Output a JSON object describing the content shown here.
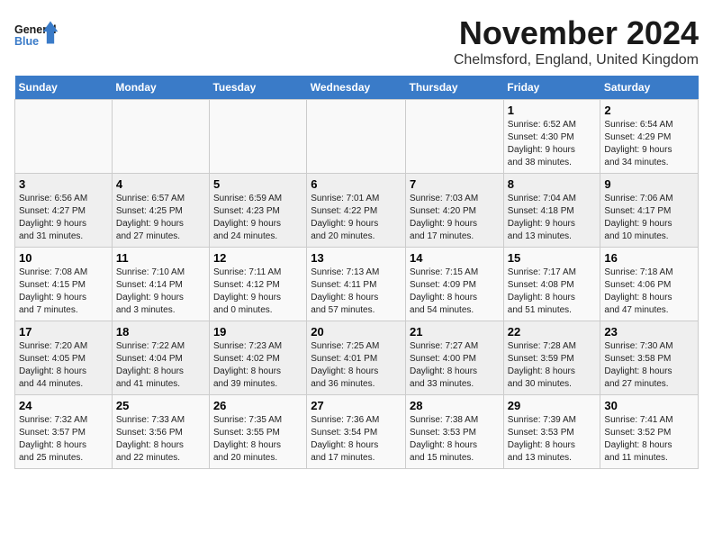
{
  "logo": {
    "line1": "General",
    "line2": "Blue"
  },
  "title": "November 2024",
  "location": "Chelmsford, England, United Kingdom",
  "weekdays": [
    "Sunday",
    "Monday",
    "Tuesday",
    "Wednesday",
    "Thursday",
    "Friday",
    "Saturday"
  ],
  "weeks": [
    [
      {
        "day": "",
        "detail": ""
      },
      {
        "day": "",
        "detail": ""
      },
      {
        "day": "",
        "detail": ""
      },
      {
        "day": "",
        "detail": ""
      },
      {
        "day": "",
        "detail": ""
      },
      {
        "day": "1",
        "detail": "Sunrise: 6:52 AM\nSunset: 4:30 PM\nDaylight: 9 hours\nand 38 minutes."
      },
      {
        "day": "2",
        "detail": "Sunrise: 6:54 AM\nSunset: 4:29 PM\nDaylight: 9 hours\nand 34 minutes."
      }
    ],
    [
      {
        "day": "3",
        "detail": "Sunrise: 6:56 AM\nSunset: 4:27 PM\nDaylight: 9 hours\nand 31 minutes."
      },
      {
        "day": "4",
        "detail": "Sunrise: 6:57 AM\nSunset: 4:25 PM\nDaylight: 9 hours\nand 27 minutes."
      },
      {
        "day": "5",
        "detail": "Sunrise: 6:59 AM\nSunset: 4:23 PM\nDaylight: 9 hours\nand 24 minutes."
      },
      {
        "day": "6",
        "detail": "Sunrise: 7:01 AM\nSunset: 4:22 PM\nDaylight: 9 hours\nand 20 minutes."
      },
      {
        "day": "7",
        "detail": "Sunrise: 7:03 AM\nSunset: 4:20 PM\nDaylight: 9 hours\nand 17 minutes."
      },
      {
        "day": "8",
        "detail": "Sunrise: 7:04 AM\nSunset: 4:18 PM\nDaylight: 9 hours\nand 13 minutes."
      },
      {
        "day": "9",
        "detail": "Sunrise: 7:06 AM\nSunset: 4:17 PM\nDaylight: 9 hours\nand 10 minutes."
      }
    ],
    [
      {
        "day": "10",
        "detail": "Sunrise: 7:08 AM\nSunset: 4:15 PM\nDaylight: 9 hours\nand 7 minutes."
      },
      {
        "day": "11",
        "detail": "Sunrise: 7:10 AM\nSunset: 4:14 PM\nDaylight: 9 hours\nand 3 minutes."
      },
      {
        "day": "12",
        "detail": "Sunrise: 7:11 AM\nSunset: 4:12 PM\nDaylight: 9 hours\nand 0 minutes."
      },
      {
        "day": "13",
        "detail": "Sunrise: 7:13 AM\nSunset: 4:11 PM\nDaylight: 8 hours\nand 57 minutes."
      },
      {
        "day": "14",
        "detail": "Sunrise: 7:15 AM\nSunset: 4:09 PM\nDaylight: 8 hours\nand 54 minutes."
      },
      {
        "day": "15",
        "detail": "Sunrise: 7:17 AM\nSunset: 4:08 PM\nDaylight: 8 hours\nand 51 minutes."
      },
      {
        "day": "16",
        "detail": "Sunrise: 7:18 AM\nSunset: 4:06 PM\nDaylight: 8 hours\nand 47 minutes."
      }
    ],
    [
      {
        "day": "17",
        "detail": "Sunrise: 7:20 AM\nSunset: 4:05 PM\nDaylight: 8 hours\nand 44 minutes."
      },
      {
        "day": "18",
        "detail": "Sunrise: 7:22 AM\nSunset: 4:04 PM\nDaylight: 8 hours\nand 41 minutes."
      },
      {
        "day": "19",
        "detail": "Sunrise: 7:23 AM\nSunset: 4:02 PM\nDaylight: 8 hours\nand 39 minutes."
      },
      {
        "day": "20",
        "detail": "Sunrise: 7:25 AM\nSunset: 4:01 PM\nDaylight: 8 hours\nand 36 minutes."
      },
      {
        "day": "21",
        "detail": "Sunrise: 7:27 AM\nSunset: 4:00 PM\nDaylight: 8 hours\nand 33 minutes."
      },
      {
        "day": "22",
        "detail": "Sunrise: 7:28 AM\nSunset: 3:59 PM\nDaylight: 8 hours\nand 30 minutes."
      },
      {
        "day": "23",
        "detail": "Sunrise: 7:30 AM\nSunset: 3:58 PM\nDaylight: 8 hours\nand 27 minutes."
      }
    ],
    [
      {
        "day": "24",
        "detail": "Sunrise: 7:32 AM\nSunset: 3:57 PM\nDaylight: 8 hours\nand 25 minutes."
      },
      {
        "day": "25",
        "detail": "Sunrise: 7:33 AM\nSunset: 3:56 PM\nDaylight: 8 hours\nand 22 minutes."
      },
      {
        "day": "26",
        "detail": "Sunrise: 7:35 AM\nSunset: 3:55 PM\nDaylight: 8 hours\nand 20 minutes."
      },
      {
        "day": "27",
        "detail": "Sunrise: 7:36 AM\nSunset: 3:54 PM\nDaylight: 8 hours\nand 17 minutes."
      },
      {
        "day": "28",
        "detail": "Sunrise: 7:38 AM\nSunset: 3:53 PM\nDaylight: 8 hours\nand 15 minutes."
      },
      {
        "day": "29",
        "detail": "Sunrise: 7:39 AM\nSunset: 3:53 PM\nDaylight: 8 hours\nand 13 minutes."
      },
      {
        "day": "30",
        "detail": "Sunrise: 7:41 AM\nSunset: 3:52 PM\nDaylight: 8 hours\nand 11 minutes."
      }
    ]
  ]
}
